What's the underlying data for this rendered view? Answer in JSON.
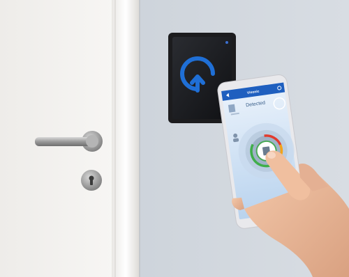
{
  "app": {
    "title": "Visonic",
    "status": "Detected"
  },
  "colors": {
    "wall": "#cfd5dc",
    "door": "#f2f0ed",
    "reader_bezel": "#1c1c1e",
    "reader_icon": "#1f6fd6",
    "app_header": "#1f5fbf",
    "app_bg": "#dbe9f7"
  },
  "icons": {
    "reader": "unlock-arrow-icon",
    "gear": "gear-icon",
    "back": "back-icon"
  }
}
